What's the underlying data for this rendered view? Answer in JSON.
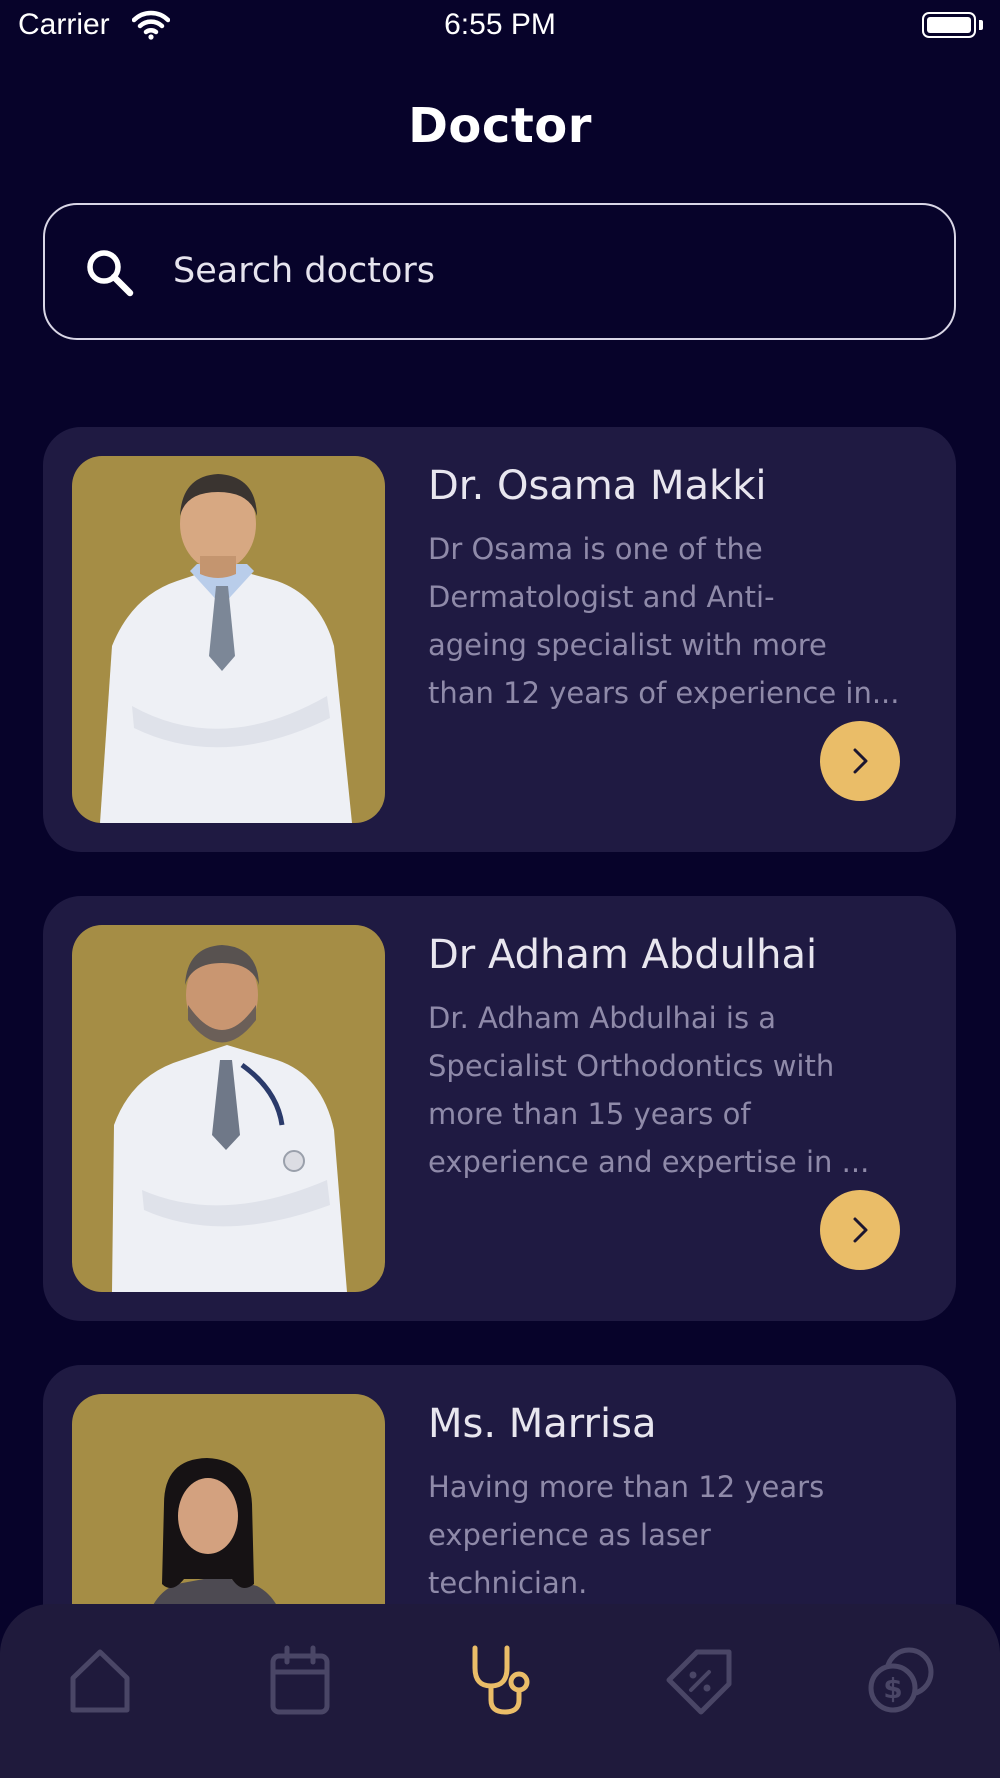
{
  "status_bar": {
    "carrier": "Carrier",
    "time": "6:55 PM"
  },
  "header": {
    "title": "Doctor"
  },
  "search": {
    "placeholder": "Search doctors",
    "value": ""
  },
  "doctors": [
    {
      "name": "Dr. Osama Makki",
      "description_lines": [
        "Dr Osama is one of the",
        "Dermatologist and Anti-",
        "ageing specialist with more",
        "than 12 years of experience in..."
      ]
    },
    {
      "name": "Dr Adham Abdulhai",
      "description_lines": [
        "Dr. Adham Abdulhai is a",
        "Specialist Orthodontics with",
        "more than 15 years of",
        "experience and expertise in ..."
      ]
    },
    {
      "name": "Ms. Marrisa",
      "description_lines": [
        "Having more than 12 years",
        "experience as laser",
        "technician."
      ]
    }
  ],
  "tab_bar": {
    "items": [
      {
        "icon": "home-icon",
        "active": false
      },
      {
        "icon": "calendar-icon",
        "active": false
      },
      {
        "icon": "stethoscope-icon",
        "active": true
      },
      {
        "icon": "discount-tag-icon",
        "active": false
      },
      {
        "icon": "coins-icon",
        "active": false
      }
    ]
  },
  "colors": {
    "background": "#07032a",
    "card": "#1f1a42",
    "photo_background": "#a58d45",
    "accent": "#eabd68",
    "muted_text": "#8f8aa9",
    "inactive_icon": "#4a4666"
  }
}
